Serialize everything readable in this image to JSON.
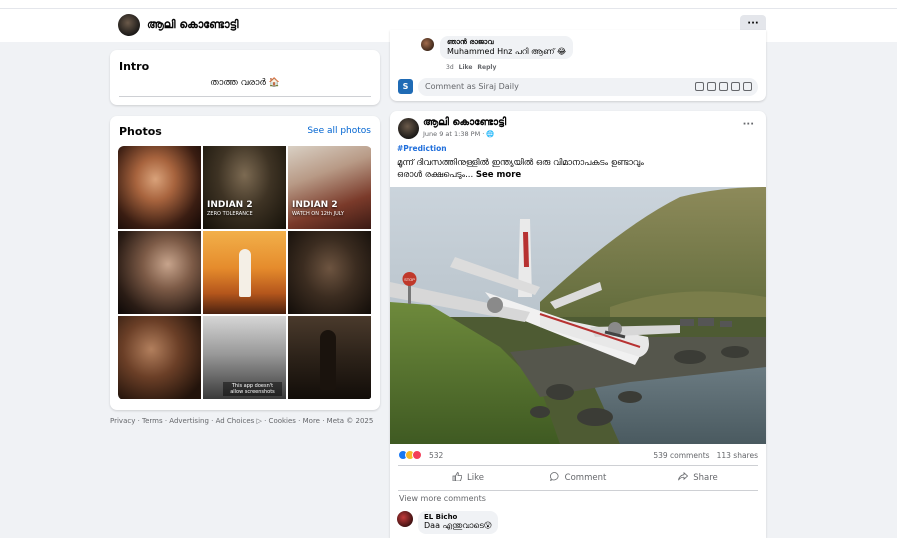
{
  "profile": {
    "name": "ആലി കൊണ്ടോട്ടി",
    "more_label": "···"
  },
  "intro": {
    "title": "Intro",
    "bio": "താത്ത വരാർ 🏠"
  },
  "photos": {
    "title": "Photos",
    "see_all": "See all photos",
    "tiles": [
      {
        "caption": "",
        "sub": ""
      },
      {
        "caption": "INDIAN 2",
        "sub": "ZERO TOLERANCE"
      },
      {
        "caption": "INDIAN 2",
        "sub": "WATCH ON 12th JULY"
      },
      {
        "caption": "",
        "sub": ""
      },
      {
        "caption": "",
        "sub": ""
      },
      {
        "caption": "",
        "sub": ""
      },
      {
        "caption": "",
        "sub": ""
      },
      {
        "caption": "",
        "sub": "",
        "note": "This app doesn't allow screenshots"
      },
      {
        "caption": "",
        "sub": ""
      }
    ]
  },
  "footer": "Privacy · Terms · Advertising · Ad Choices ▷ · Cookies · More · Meta © 2025",
  "prev_comment": {
    "name": "ഞാൻ രാജാവ",
    "text": "Muhammed Hnz പറി ആണ് 😂",
    "time": "3d",
    "like": "Like",
    "reply": "Reply",
    "commentbox_avatar": "S",
    "commentbox_placeholder": "Comment as Siraj Daily"
  },
  "post": {
    "author": "ആലി കൊണ്ടോട്ടി",
    "time": "June 9 at 1:38 PM · 🌐",
    "more": "···",
    "hashtag": "#Prediction",
    "text_line1": "മൂന്ന് ദിവസത്തിനുള്ളിൽ ഇന്ത്യയിൽ ഒരു വിമാനാപകടം ഉണ്ടാവും",
    "text_line2": "ഒരാൾ രക്ഷപെടും...",
    "see_more": "See more",
    "reactions_count": "532",
    "comments_count": "539 comments",
    "shares_count": "113 shares",
    "like_label": "Like",
    "comment_label": "Comment",
    "share_label": "Share",
    "view_more": "View more comments",
    "stop_sign": "STOP",
    "comment": {
      "name": "EL Bicho",
      "text": "Daa എന്തുവാടെ😮"
    }
  },
  "colors": {
    "link": "#0064d1",
    "hashtag": "#216fdb",
    "like": "#1877f2",
    "haha": "#f7b928",
    "love": "#f33e58"
  }
}
